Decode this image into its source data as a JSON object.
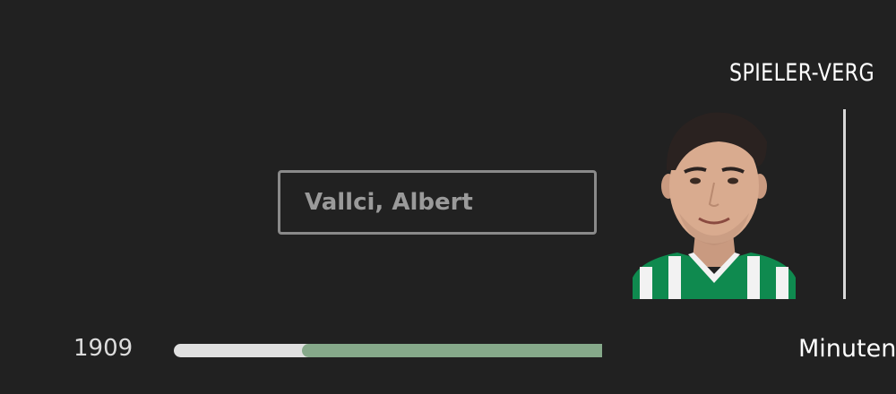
{
  "header": {
    "title": "SPIELER-VERG"
  },
  "player": {
    "name": "Vallci, Albert",
    "photo_alt": "player-portrait",
    "jersey_colors": {
      "green": "#0f8a4f",
      "white": "#f2f2f2"
    }
  },
  "stat": {
    "value": "1909",
    "label": "Minuten",
    "bar_fraction": 0.7,
    "bar_fill_color": "#86a98a",
    "bar_track_color": "#e0e0e0"
  },
  "colors": {
    "background": "#212121",
    "divider": "#d8d8d8",
    "select_border": "#8a8a8a"
  }
}
